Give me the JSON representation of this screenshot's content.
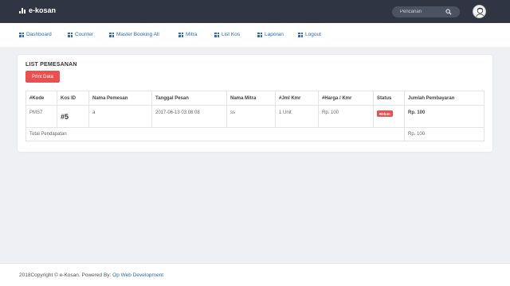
{
  "app": {
    "brand": "e-kosan"
  },
  "search": {
    "placeholder": "Pencarian"
  },
  "nav": {
    "items": [
      "Dashboard",
      "Counter",
      "Master Booking All",
      "Mitra",
      "List Kos",
      "Laporan",
      "Logout"
    ]
  },
  "panel": {
    "title": "LIST PEMESANAN",
    "print_label": "Print Data",
    "columns": [
      "#Kode",
      "Kos ID",
      "Nama Pemesan",
      "Tanggal Pesan",
      "Nama Mitra",
      "#Jml Kmr",
      "#Harga / Kmr",
      "Status",
      "Jumlah Pembayaran"
    ],
    "rows": [
      {
        "kode": "PMS7",
        "kos_id": "#5",
        "nama_pemesan": "a",
        "tanggal": "2017-06-13 03:08:08",
        "mitra": "ss",
        "jml_kmr": "1 Unit",
        "harga": "Rp. 100",
        "status": "Belum",
        "jumlah": "Rp. 100"
      }
    ],
    "total_label": "Total Pendapatan",
    "total_value": "Rp. 100"
  },
  "footer": {
    "text": "2018Copyright © e-Kosan. Powered By:",
    "link": "Op Web Development"
  },
  "colors": {
    "topbar": "#2f3542",
    "accent": "#2a6cb5",
    "danger": "#e9504f"
  }
}
